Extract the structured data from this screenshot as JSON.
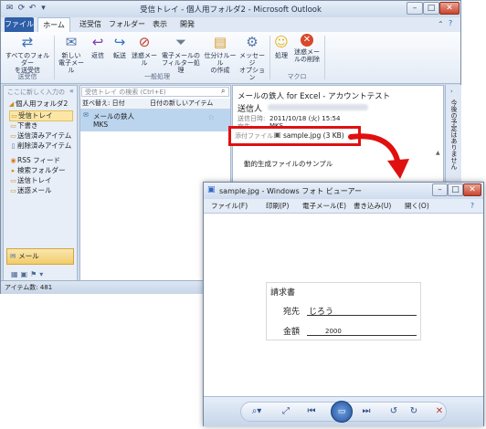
{
  "outlook": {
    "title": "受信トレイ - 個人用フォルダ2 - Microsoft Outlook",
    "tabs": [
      "ファイル",
      "ホーム",
      "送受信",
      "フォルダー",
      "表示",
      "開発"
    ],
    "ribbon": {
      "buttons": [
        {
          "label": "すべてのフォルダー\nを送受信",
          "icon": "send-receive-icon"
        },
        {
          "label": "新しい\n電子メール",
          "icon": "new-mail-icon"
        },
        {
          "label": "返信",
          "icon": "reply-icon"
        },
        {
          "label": "転送",
          "icon": "forward-icon"
        },
        {
          "label": "迷惑メール",
          "icon": "junk-icon"
        },
        {
          "label": "電子メールの\nフィルター処理",
          "icon": "filter-icon"
        },
        {
          "label": "仕分けルール\nの作成",
          "icon": "rules-icon"
        },
        {
          "label": "メッセージ\nオプション",
          "icon": "options-icon"
        },
        {
          "label": "処理",
          "icon": "smile-icon"
        },
        {
          "label": "迷惑メー\nルの削除",
          "icon": "delete-junk-icon"
        }
      ],
      "groups": [
        "送受信",
        "一般処理",
        "マクロ"
      ]
    },
    "nav": {
      "header": "ここに新しく入力の",
      "root": "個人用フォルダ2",
      "folders": [
        "受信トレイ",
        "下書き",
        "送信済みアイテム",
        "削除済みアイテム",
        "RSS フィード",
        "検索フォルダー",
        "送信トレイ",
        "迷惑メール"
      ],
      "mail_label": "メール"
    },
    "list": {
      "search_placeholder": "受信トレイ の検索 (Ctrl+E)",
      "sort_by": "並べ替え: 日付",
      "sort_order": "日付の新しいアイテム",
      "message_subject": "メールの鉄人",
      "message_sender": "MKS"
    },
    "read": {
      "subject": "メールの鉄人 for Excel - アカウントテスト",
      "from_label": "送信人",
      "sent_label": "送信日時:",
      "sent_value": "2011/10/18 (火) 15:54",
      "to_label": "宛先:",
      "to_value": "MKS",
      "attach_label": "添付ファイル:",
      "attach_file": "sample.jpg (3 KB)",
      "body": "動的生成ファイルのサンプル"
    },
    "todo_label": "今後の予定はありません",
    "status": "アイテム数: 481"
  },
  "viewer": {
    "title": "sample.jpg - Windows フォト ビューアー",
    "menus": [
      "ファイル(F)",
      "印刷(P)",
      "電子メール(E)",
      "書き込み(U)",
      "開く(O)"
    ],
    "doc": {
      "heading": "請求書",
      "name_label": "宛先",
      "name_value": "じろう",
      "amount_label": "金額",
      "amount_value": "2000"
    }
  },
  "colors": {
    "accent": "#2e5fa8",
    "callout": "#e01010",
    "selection": "#bcd5ef"
  }
}
